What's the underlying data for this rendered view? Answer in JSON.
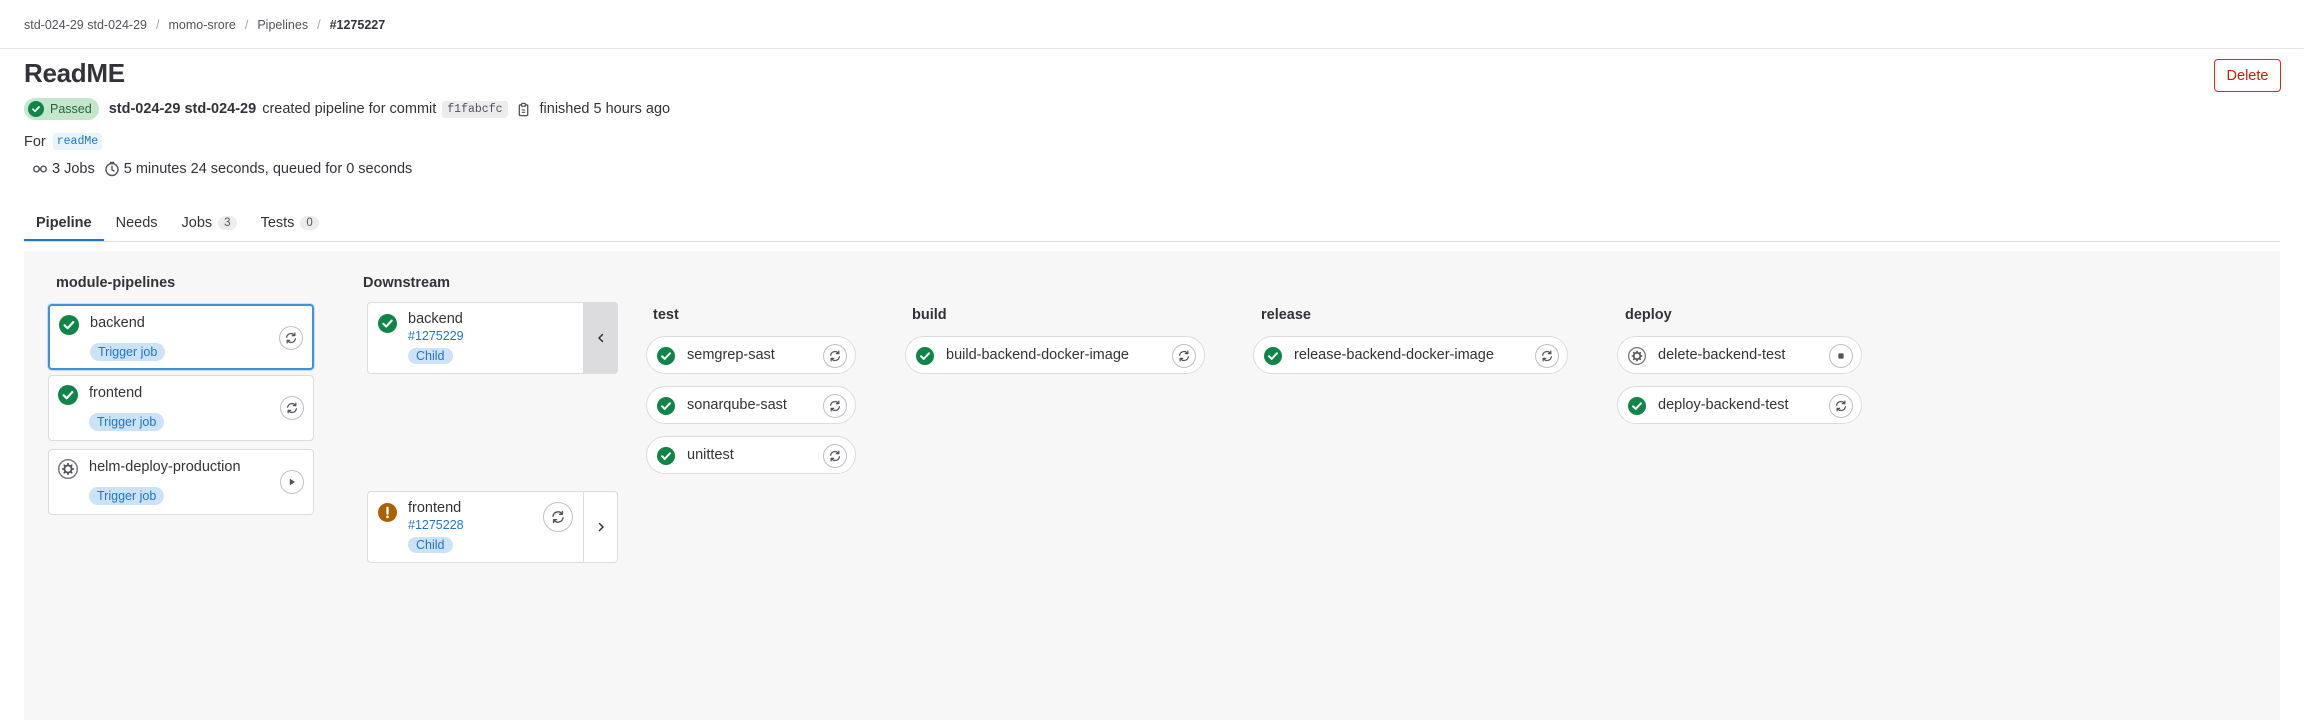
{
  "breadcrumb": {
    "items": [
      "std-024-29 std-024-29",
      "momo-srore",
      "Pipelines",
      "#1275227"
    ]
  },
  "header": {
    "title": "ReadME",
    "delete_label": "Delete"
  },
  "meta": {
    "status": "Passed",
    "author": "std-024-29 std-024-29",
    "action_text": "created pipeline for commit",
    "sha": "f1fabcfc",
    "finished": "finished 5 hours ago"
  },
  "ref": {
    "prefix": "For",
    "name": "readMe"
  },
  "stats": {
    "jobs": "3 Jobs",
    "duration": "5 minutes 24 seconds, queued for 0 seconds"
  },
  "tabs": [
    {
      "label": "Pipeline",
      "count": null,
      "active": true
    },
    {
      "label": "Needs",
      "count": null,
      "active": false
    },
    {
      "label": "Jobs",
      "count": "3",
      "active": false
    },
    {
      "label": "Tests",
      "count": "0",
      "active": false
    }
  ],
  "graph": {
    "trigger_column": {
      "title": "module-pipelines",
      "jobs": [
        {
          "name": "backend",
          "badge": "Trigger job",
          "status": "success",
          "action": "retry-icon"
        },
        {
          "name": "frontend",
          "badge": "Trigger job",
          "status": "success",
          "action": "retry-icon"
        },
        {
          "name": "helm-deploy-production",
          "badge": "Trigger job",
          "status": "manual",
          "action": "play-icon"
        }
      ]
    },
    "downstream": {
      "title": "Downstream",
      "pipelines": [
        {
          "name": "backend",
          "id": "#1275229",
          "badge": "Child",
          "status": "success"
        },
        {
          "name": "frontend",
          "id": "#1275228",
          "badge": "Child",
          "status": "warning"
        }
      ]
    },
    "stages": [
      {
        "title": "test",
        "jobs": [
          {
            "name": "semgrep-sast",
            "status": "success",
            "action": "retry-icon"
          },
          {
            "name": "sonarqube-sast",
            "status": "success",
            "action": "retry-icon"
          },
          {
            "name": "unittest",
            "status": "success",
            "action": "retry-icon"
          }
        ]
      },
      {
        "title": "build",
        "jobs": [
          {
            "name": "build-backend-docker-image",
            "status": "success",
            "action": "retry-icon"
          }
        ]
      },
      {
        "title": "release",
        "jobs": [
          {
            "name": "release-backend-docker-image",
            "status": "success",
            "action": "retry-icon"
          }
        ]
      },
      {
        "title": "deploy",
        "jobs": [
          {
            "name": "delete-backend-test",
            "status": "manual",
            "action": "stop-icon"
          },
          {
            "name": "deploy-backend-test",
            "status": "success",
            "action": "retry-icon"
          }
        ]
      }
    ]
  },
  "colors": {
    "success": "#108548",
    "warning": "#ab6100",
    "link": "#1f75cb",
    "danger": "#dd2b0e"
  }
}
